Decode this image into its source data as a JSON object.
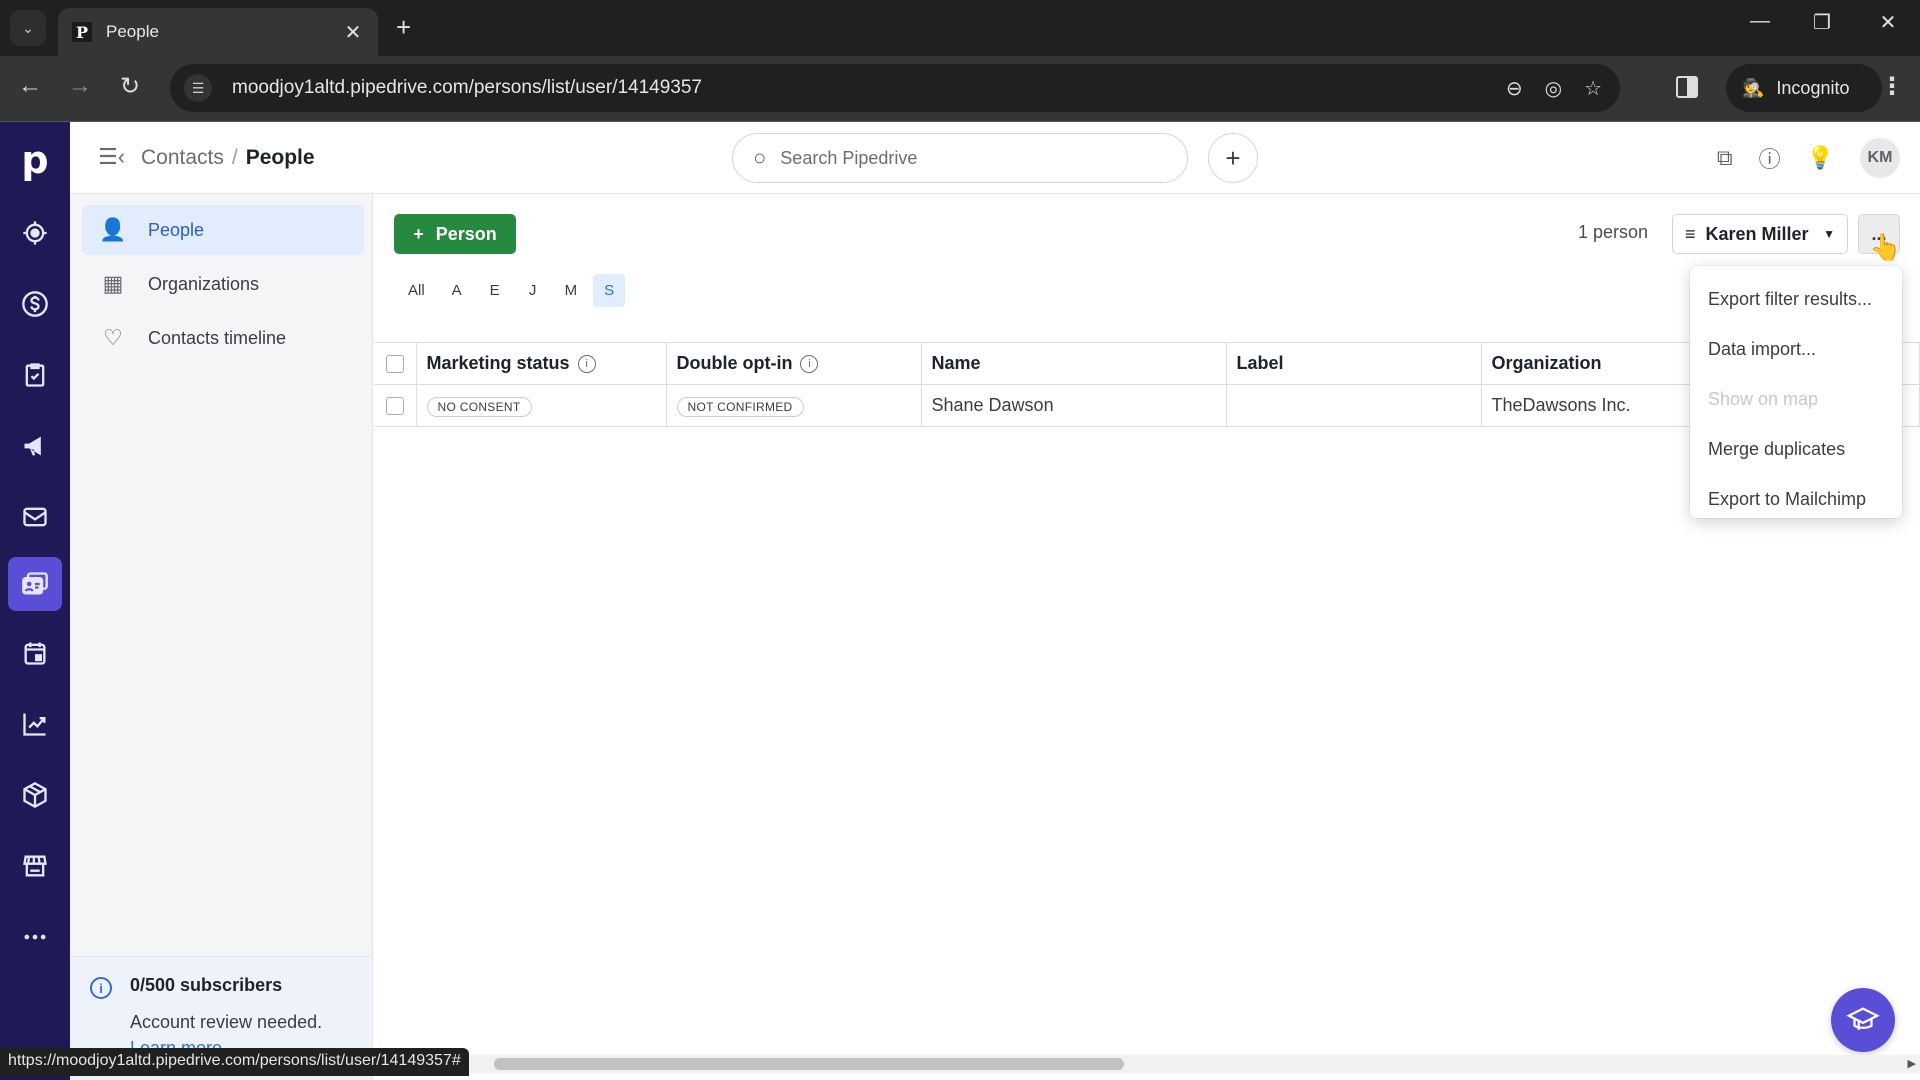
{
  "browser": {
    "tab_title": "People",
    "tab_favicon": "P",
    "url": "moodjoy1altd.pipedrive.com/persons/list/user/14149357",
    "incognito_label": "Incognito",
    "status_url": "https://moodjoy1altd.pipedrive.com/persons/list/user/14149357#"
  },
  "rail": {
    "logo": "p",
    "items": [
      {
        "name": "leads",
        "icon": "target-icon"
      },
      {
        "name": "deals",
        "icon": "dollar-icon"
      },
      {
        "name": "activities",
        "icon": "clipboard-check-icon"
      },
      {
        "name": "campaigns",
        "icon": "megaphone-icon"
      },
      {
        "name": "mail",
        "icon": "mail-icon"
      },
      {
        "name": "contacts",
        "icon": "contact-card-icon",
        "active": true
      },
      {
        "name": "calendar",
        "icon": "calendar-icon"
      },
      {
        "name": "insights",
        "icon": "chart-icon"
      },
      {
        "name": "products",
        "icon": "box-icon"
      },
      {
        "name": "marketplace",
        "icon": "store-icon"
      },
      {
        "name": "more",
        "icon": "more-icon"
      }
    ]
  },
  "header": {
    "breadcrumb": [
      "Contacts",
      "People"
    ],
    "separator": "/",
    "search_placeholder": "Search Pipedrive",
    "avatar_initials": "KM"
  },
  "subnav": {
    "items": [
      {
        "label": "People",
        "active": true
      },
      {
        "label": "Organizations"
      },
      {
        "label": "Contacts timeline"
      }
    ],
    "footer": {
      "title": "0/500 subscribers",
      "text": "Account review needed.",
      "link": "Learn more"
    }
  },
  "main": {
    "add_button": "Person",
    "alphabet": [
      "All",
      "A",
      "E",
      "J",
      "M",
      "S"
    ],
    "alphabet_active": "S",
    "count": "1 person",
    "filter_label": "Karen Miller",
    "more_label": "...",
    "table": {
      "columns": [
        "Marketing status",
        "Double opt-in",
        "Name",
        "Label",
        "Organization"
      ],
      "rows": [
        {
          "marketing_status": "NO CONSENT",
          "double_opt_in": "NOT CONFIRMED",
          "name": "Shane Dawson",
          "label": "",
          "organization": "TheDawsons Inc."
        }
      ]
    },
    "menu": [
      {
        "label": "Export filter results...",
        "disabled": false
      },
      {
        "label": "Data import...",
        "disabled": false
      },
      {
        "label": "Show on map",
        "disabled": true
      },
      {
        "label": "Merge duplicates",
        "disabled": false
      },
      {
        "label": "Export to Mailchimp",
        "disabled": false
      }
    ]
  },
  "colors": {
    "rail_bg": "#1f1a56",
    "rail_active": "#5b4ed6",
    "primary_green": "#258a3f",
    "link_blue": "#2f6fd1"
  }
}
